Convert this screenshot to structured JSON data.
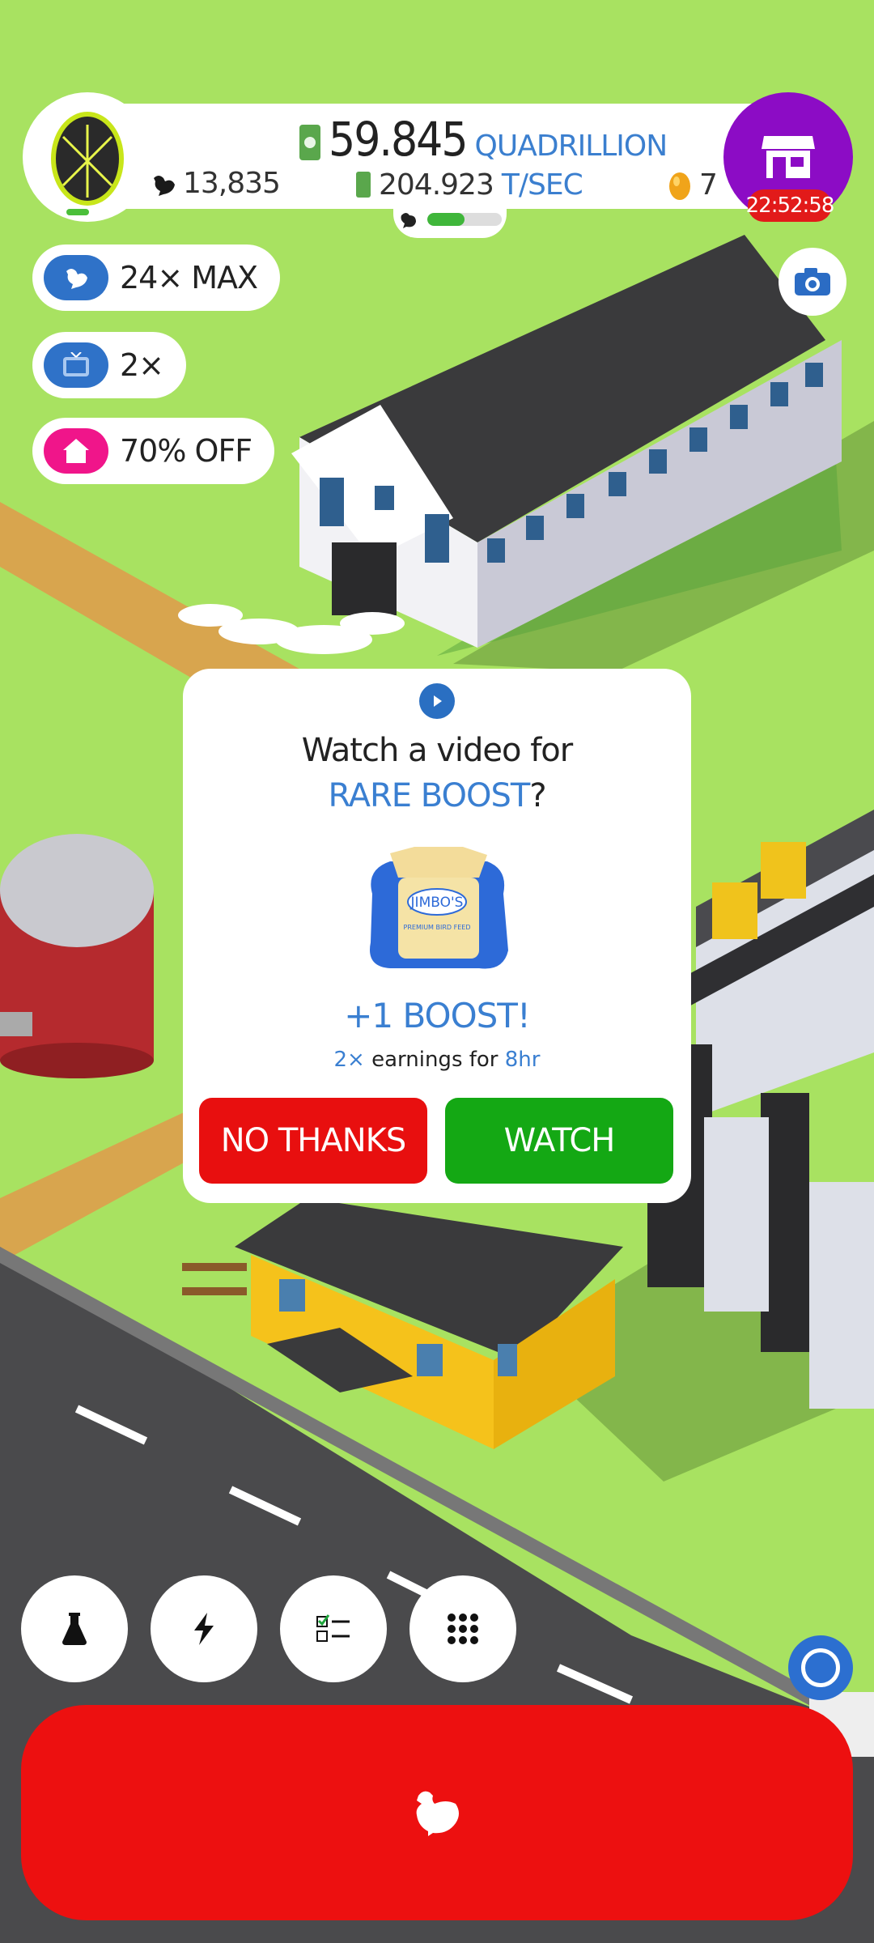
{
  "hud": {
    "money_value": "59.845",
    "money_unit": "QUADRILLION",
    "rate_value": "204.923",
    "rate_unit": "T/SEC",
    "chicken_count": "13,835",
    "golden_eggs": "7",
    "shop_timer": "22:52:58",
    "progress_fraction": 0.5
  },
  "boosts": [
    {
      "label": "24× MAX",
      "icon": "chicken-icon",
      "color": "#2f72c8"
    },
    {
      "label": "2×",
      "icon": "tv-icon",
      "color": "#2f72c8"
    },
    {
      "label": "70% OFF",
      "icon": "house-icon",
      "color": "#f0158a"
    }
  ],
  "dialog": {
    "title": "Watch a video for",
    "highlight": "RARE BOOST",
    "question_mark": "?",
    "bag_brand": "JIMBO'S",
    "bag_sub": "PREMIUM BIRD FEED",
    "boost_label": "+1 BOOST!",
    "earn_mult": "2×",
    "earn_text": " earnings for ",
    "earn_time": "8hr",
    "no_label": "NO THANKS",
    "watch_label": "WATCH"
  },
  "controls": [
    {
      "name": "research-button",
      "icon": "flask-icon"
    },
    {
      "name": "boost-button",
      "icon": "lightning-icon"
    },
    {
      "name": "missions-button",
      "icon": "checklist-icon"
    },
    {
      "name": "menu-button",
      "icon": "grid-icon"
    }
  ],
  "colors": {
    "grass": "#a8e261",
    "accent_blue": "#3a7fd1",
    "watch_green": "#14a814",
    "hatch_red": "#ed1010",
    "shop_purple": "#8c0cc5"
  }
}
